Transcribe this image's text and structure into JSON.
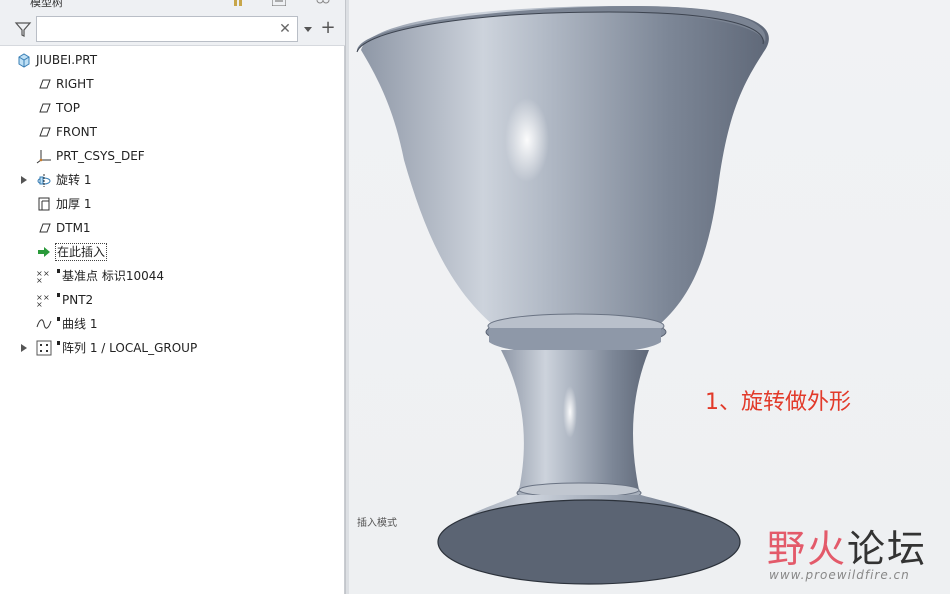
{
  "panel": {
    "title": "模型树",
    "search_placeholder": ""
  },
  "tree": {
    "items": [
      {
        "label": "JIUBEI.PRT",
        "icon": "part-icon"
      },
      {
        "label": "RIGHT",
        "icon": "datum-plane-icon"
      },
      {
        "label": "TOP",
        "icon": "datum-plane-icon"
      },
      {
        "label": "FRONT",
        "icon": "datum-plane-icon"
      },
      {
        "label": "PRT_CSYS_DEF",
        "icon": "csys-icon"
      },
      {
        "label": "旋转 1",
        "icon": "revolve-icon",
        "expandable": true
      },
      {
        "label": "加厚 1",
        "icon": "thicken-icon"
      },
      {
        "label": "DTM1",
        "icon": "datum-plane-icon"
      },
      {
        "label": "在此插入",
        "icon": "insert-here-arrow-icon"
      },
      {
        "label": "基准点 标识10044",
        "icon": "datum-point-icon"
      },
      {
        "label": "PNT2",
        "icon": "datum-point-icon"
      },
      {
        "label": "曲线 1",
        "icon": "curve-icon"
      },
      {
        "label": "阵列 1 / LOCAL_GROUP",
        "icon": "pattern-icon",
        "expandable": true
      }
    ]
  },
  "viewport": {
    "annotation": "1、旋转做外形",
    "mode_label": "插入模式",
    "watermark_title_a": "野火",
    "watermark_title_b": "论坛",
    "watermark_url": "www.proewildfire.cn"
  },
  "colors": {
    "annotation": "#e23a2a",
    "model_base": "#8c96a6",
    "watermark_accent": "#e35a6a"
  }
}
